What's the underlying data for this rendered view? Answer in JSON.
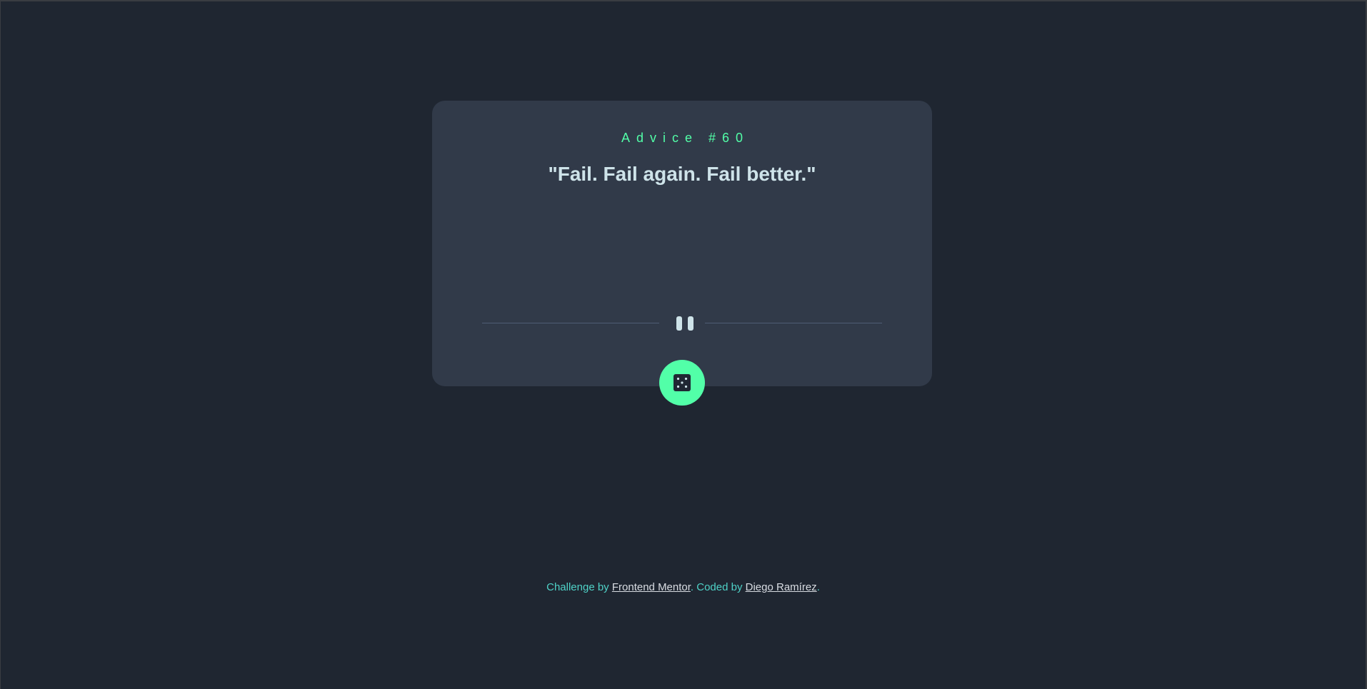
{
  "card": {
    "advice_label": "Advice #60",
    "quote": "\"Fail. Fail again. Fail better.\"",
    "dice_icon": "dice-icon",
    "divider_icon": "pause-icon"
  },
  "footer": {
    "challenge_prefix": "Challenge by ",
    "challenge_link": "Frontend Mentor",
    "coded_prefix": ". Coded by ",
    "coded_link": "Diego Ramírez",
    "suffix": "."
  },
  "colors": {
    "background": "#1f2631",
    "card": "#313a49",
    "accent": "#52ffa8",
    "quote_text": "#cee3e9",
    "footer_text": "#4fd2c7"
  }
}
